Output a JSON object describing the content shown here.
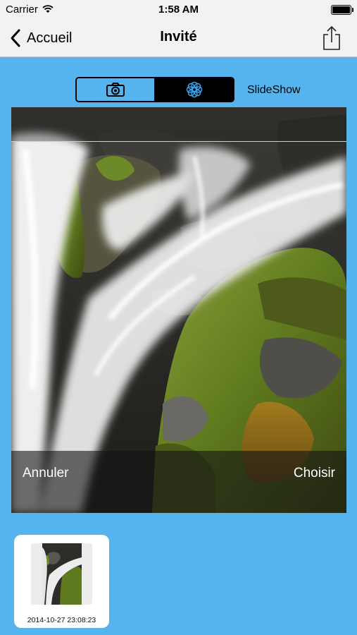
{
  "status_bar": {
    "carrier": "Carrier",
    "time": "1:58 AM",
    "wifi_icon": "wifi-icon",
    "battery_icon": "battery-icon"
  },
  "nav": {
    "back_label": "Accueil",
    "title": "Invité",
    "share_icon": "share-icon"
  },
  "mode_selector": {
    "segments": [
      {
        "icon": "camera-icon",
        "selected": false
      },
      {
        "icon": "flower-icon",
        "selected": true
      }
    ],
    "label": "SlideShow"
  },
  "preview": {
    "cancel_label": "Annuler",
    "choose_label": "Choisir"
  },
  "thumbnails": [
    {
      "date": "2014-10-27 23:08:23"
    }
  ],
  "colors": {
    "background": "#55b4ee",
    "nav_background": "#f2f2f4",
    "moss": "#5f7a1e"
  }
}
